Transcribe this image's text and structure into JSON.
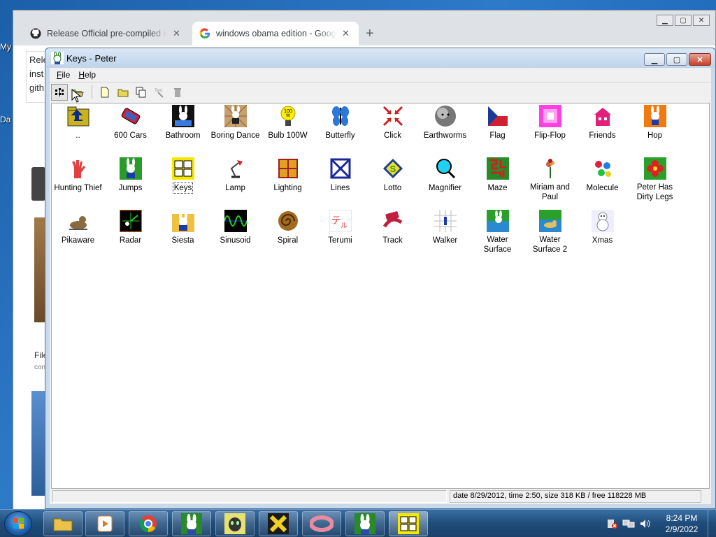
{
  "desktop": {
    "label_1": "My",
    "label_2": "Da"
  },
  "browser": {
    "tabs": [
      {
        "label": "Release Official pre-compiled ins",
        "icon": "github-icon"
      },
      {
        "label": "windows obama edition - Google",
        "icon": "google-icon"
      }
    ],
    "page_fragment": [
      "Rele",
      "inst",
      "gith"
    ],
    "side_text": [
      "File",
      "con"
    ]
  },
  "keys_window": {
    "title": "Keys - Peter",
    "menu": [
      {
        "label": "File",
        "accel": "F"
      },
      {
        "label": "Help",
        "accel": "H"
      }
    ],
    "items": [
      {
        "label": "..",
        "icon": "folder-up-icon"
      },
      {
        "label": "600 Cars",
        "icon": "cars-icon"
      },
      {
        "label": "Bathroom",
        "icon": "bunny-bath-icon"
      },
      {
        "label": "Boring Dance",
        "icon": "bunny-dance-icon"
      },
      {
        "label": "Bulb 100W",
        "icon": "bulb-icon"
      },
      {
        "label": "Butterfly",
        "icon": "butterfly-icon"
      },
      {
        "label": "Click",
        "icon": "click-arrows-icon"
      },
      {
        "label": "Earthworms",
        "icon": "earthworm-ball-icon"
      },
      {
        "label": "Flag",
        "icon": "flag-icon"
      },
      {
        "label": "Flip-Flop",
        "icon": "flip-flop-icon"
      },
      {
        "label": "Friends",
        "icon": "house-icon"
      },
      {
        "label": "Hop",
        "icon": "bunny-hop-icon"
      },
      {
        "label": "Hunting Thief",
        "icon": "hand-icon"
      },
      {
        "label": "Jumps",
        "icon": "bunny-jump-icon"
      },
      {
        "label": "Keys",
        "icon": "keys-icon"
      },
      {
        "label": "Lamp",
        "icon": "lamp-icon"
      },
      {
        "label": "Lighting",
        "icon": "window-icon"
      },
      {
        "label": "Lines",
        "icon": "lines-icon"
      },
      {
        "label": "Lotto",
        "icon": "lotto-icon"
      },
      {
        "label": "Magnifier",
        "icon": "magnifier-icon"
      },
      {
        "label": "Maze",
        "icon": "maze-icon"
      },
      {
        "label": "Miriam and Paul",
        "icon": "flowers-icon"
      },
      {
        "label": "Molecule",
        "icon": "molecule-icon"
      },
      {
        "label": "Peter Has Dirty Legs",
        "icon": "red-flower-icon"
      },
      {
        "label": "Pikaware",
        "icon": "pika-icon"
      },
      {
        "label": "Radar",
        "icon": "radar-icon"
      },
      {
        "label": "Siesta",
        "icon": "bunny-siesta-icon"
      },
      {
        "label": "Sinusoid",
        "icon": "sinusoid-icon"
      },
      {
        "label": "Spiral",
        "icon": "spiral-icon"
      },
      {
        "label": "Terumi",
        "icon": "terumi-icon"
      },
      {
        "label": "Track",
        "icon": "track-icon"
      },
      {
        "label": "Walker",
        "icon": "walker-icon"
      },
      {
        "label": "Water Surface",
        "icon": "water-bunny-icon"
      },
      {
        "label": "Water Surface 2",
        "icon": "water-duck-icon"
      },
      {
        "label": "Xmas",
        "icon": "snowman-icon"
      }
    ],
    "selected_item": "Keys",
    "status": "date 8/29/2012, time 2:50, size 318 KB / free 118228 MB"
  },
  "taskbar": {
    "clock_time": "8:24 PM",
    "clock_date": "2/9/2022"
  },
  "colors": {
    "desktop_blue": "#1c5fa8",
    "titlebar": "#c9d9ec",
    "close_red": "#c7412a",
    "selection_outline": "#333333"
  }
}
